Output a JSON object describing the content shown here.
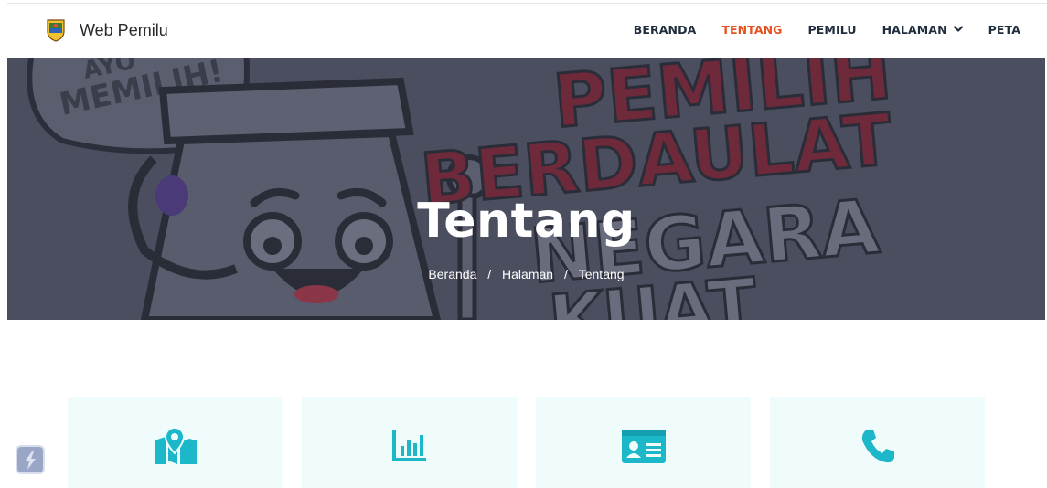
{
  "brand": {
    "name": "Web Pemilu",
    "logo_icon": "regency-crest-icon"
  },
  "nav": {
    "items": [
      {
        "label": "BERANDA",
        "active": false
      },
      {
        "label": "TENTANG",
        "active": true
      },
      {
        "label": "PEMILU",
        "active": false
      },
      {
        "label": "HALAMAN",
        "active": false,
        "has_dropdown": true
      },
      {
        "label": "PETA",
        "active": false
      }
    ],
    "active_color": "#e5511f"
  },
  "hero": {
    "title": "Tentang",
    "background_art_text": [
      "AYO",
      "MEMILIH!",
      "PEMILIH",
      "BERDAULAT",
      "NEGARA",
      "KUAT"
    ],
    "breadcrumb": [
      {
        "label": "Beranda"
      },
      {
        "label": "Halaman"
      },
      {
        "label": "Tentang"
      }
    ],
    "separator": "/"
  },
  "features": [
    {
      "icon": "map-location-icon"
    },
    {
      "icon": "bar-chart-icon"
    },
    {
      "icon": "id-card-icon"
    },
    {
      "icon": "phone-icon"
    }
  ],
  "colors": {
    "accent": "#1cb7c9",
    "card_bg": "#effcfb",
    "hero_overlay": "#4b4f60"
  },
  "floating_button": {
    "icon": "lightning-icon"
  }
}
